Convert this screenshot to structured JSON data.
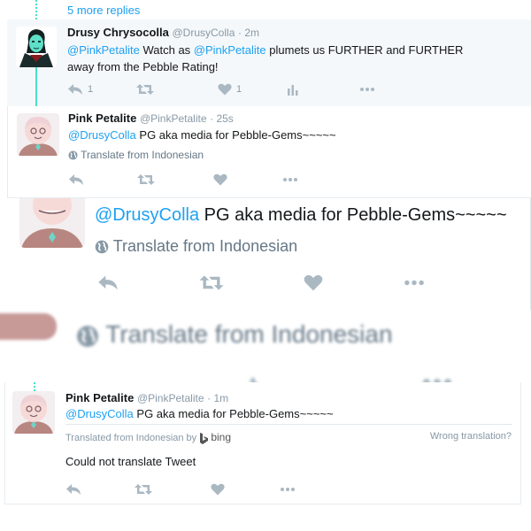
{
  "thread": {
    "more_replies": "5 more replies"
  },
  "tweet1": {
    "name": "Drusy Chrysocolla",
    "handle": "@DrusyColla",
    "time": "· 2m",
    "mention1": "@PinkPetalite",
    "text_a": " Watch as ",
    "mention2": "@PinkPetalite",
    "text_b": " plumets us FURTHER and FURTHER",
    "text_c": "away from the Pebble Rating!",
    "reply_count": "1",
    "like_count": "1"
  },
  "tweet2": {
    "name": "Pink Petalite",
    "handle": "@PinkPetalite",
    "time": "· 25s",
    "mention": "@DrusyColla",
    "text": " PG aka media for Pebble-Gems~~~~~",
    "translate": "Translate from Indonesian"
  },
  "zoom": {
    "mention": "@DrusyColla",
    "text": " PG aka media for Pebble-Gems~~~~~",
    "translate": "Translate from Indonesian"
  },
  "blur": {
    "translate": "Translate from Indonesian"
  },
  "tweet3": {
    "name": "Pink Petalite",
    "handle": "@PinkPetalite",
    "time": "· 1m",
    "mention": "@DrusyColla",
    "text": " PG aka media for Pebble-Gems~~~~~",
    "translated_from": "Translated from Indonesian by",
    "bing": "bing",
    "wrong_translation": "Wrong translation?",
    "result": "Could not translate Tweet"
  },
  "colors": {
    "link": "#1da1f2",
    "muted": "#8899a6",
    "icon": "#aab8c2",
    "thread": "#4ae0c9"
  },
  "icons": [
    "reply-icon",
    "retweet-icon",
    "heart-icon",
    "analytics-icon",
    "more-icon",
    "globe-icon",
    "bing-logo"
  ]
}
